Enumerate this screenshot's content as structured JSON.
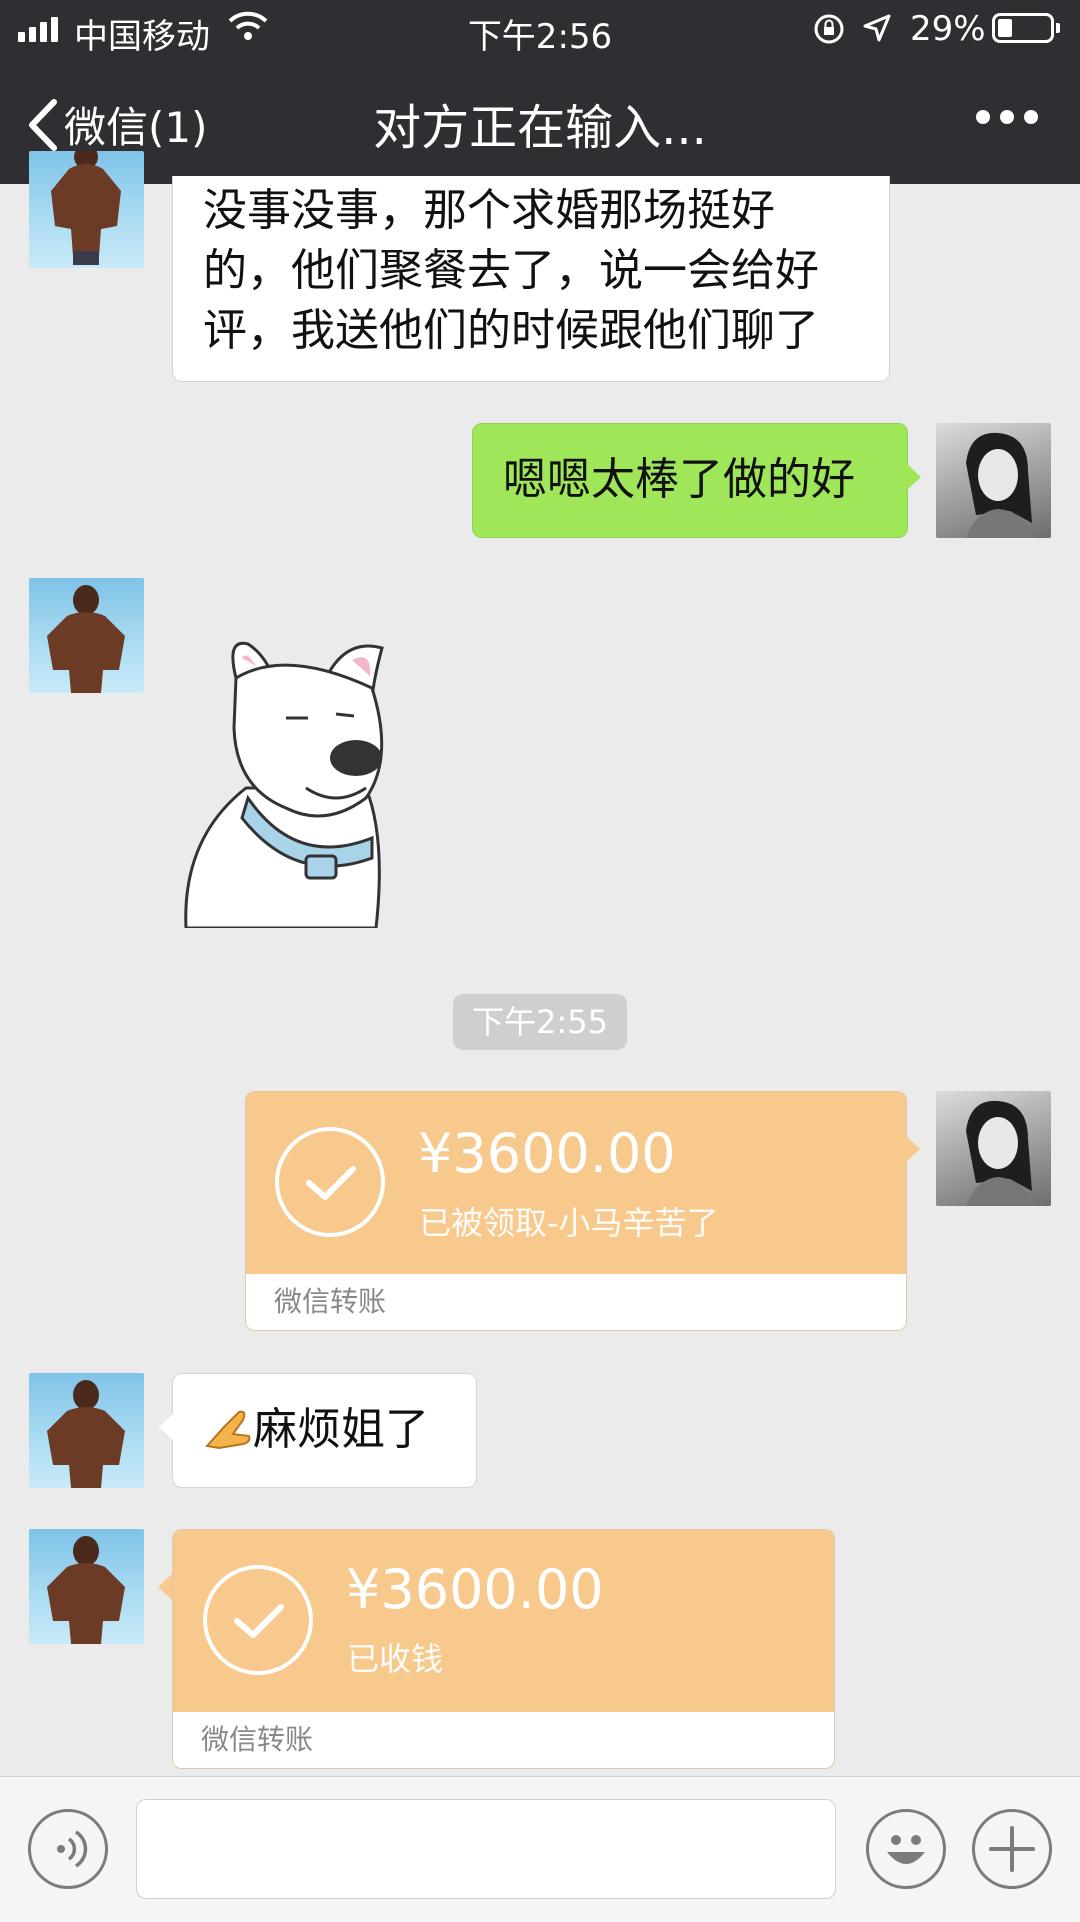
{
  "status_bar": {
    "carrier": "中国移动",
    "time": "下午2:56",
    "battery": "29%",
    "battery_level": 0.29
  },
  "nav": {
    "back_label": "微信(1)",
    "title": "对方正在输入..."
  },
  "messages": {
    "m1_text": "没事没事，那个求婚那场挺好的，他们聚餐去了，说一会给好评，我送他们的时候跟他们聊了",
    "m2_text": "嗯嗯太棒了做的好",
    "timestamp": "下午2:55",
    "transfer1": {
      "amount": "¥3600.00",
      "note": "已被领取-小马辛苦了",
      "footer": "微信转账"
    },
    "m4_text": "麻烦姐了",
    "transfer2": {
      "amount": "¥3600.00",
      "note": "已收钱",
      "footer": "微信转账"
    }
  },
  "input": {
    "value": ""
  },
  "colors": {
    "bar": "#2f2f33",
    "chat_bg": "#ebebeb",
    "outgoing_bubble": "#9fe658",
    "transfer": "#f8c98c"
  },
  "icons": {
    "back": "chevron-left-icon",
    "more": "more-dots-icon",
    "voice": "voice-icon",
    "emoji": "emoji-icon",
    "plus": "plus-icon"
  }
}
